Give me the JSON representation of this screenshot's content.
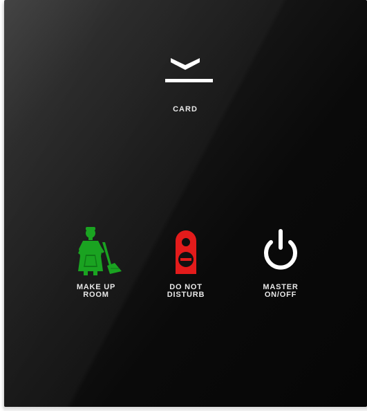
{
  "panel": {
    "card": {
      "icon": "card-slot-icon",
      "label": "CARD"
    },
    "buttons": [
      {
        "icon": "housekeeping-maid-icon",
        "color": "#1aa321",
        "line1": "MAKE UP",
        "line2": "ROOM"
      },
      {
        "icon": "door-hanger-icon",
        "color": "#e31b1b",
        "line1": "DO NOT",
        "line2": "DISTURB"
      },
      {
        "icon": "power-icon",
        "color": "#ffffff",
        "line1": "MASTER",
        "line2": "ON/OFF"
      }
    ]
  }
}
